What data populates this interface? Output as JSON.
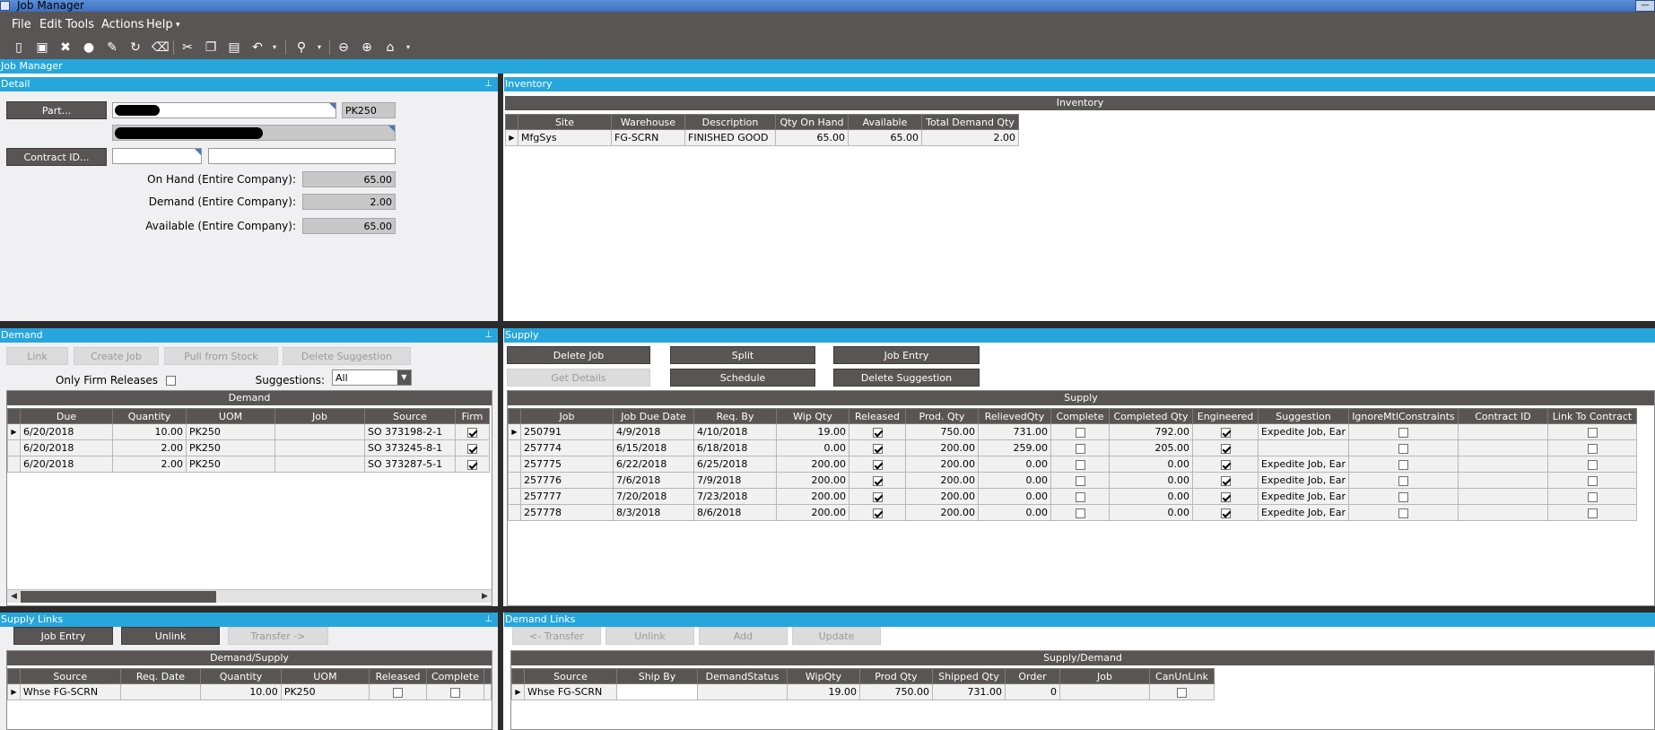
{
  "window": {
    "title": "Job Manager"
  },
  "menu": {
    "file": "File",
    "edit": "Edit",
    "tools": "Tools",
    "actions": "Actions",
    "help": "Help"
  },
  "app_strip": "Job Manager",
  "detail": {
    "title": "Detail",
    "part_button": "Part...",
    "part_value": "",
    "uom_value": "PK250",
    "description_value": "",
    "contract_button": "Contract ID...",
    "contract_value": "",
    "contract_desc": "",
    "on_hand_label": "On Hand (Entire Company):",
    "on_hand_value": "65.00",
    "demand_label": "Demand (Entire Company):",
    "demand_value": "2.00",
    "available_label": "Available (Entire Company):",
    "available_value": "65.00"
  },
  "inventory": {
    "title": "Inventory",
    "caption": "Inventory",
    "columns": [
      "Site",
      "Warehouse",
      "Description",
      "Qty On Hand",
      "Available",
      "Total Demand Qty"
    ],
    "rows": [
      [
        "MfgSys",
        "FG-SCRN",
        "FINISHED GOOD",
        "65.00",
        "65.00",
        "2.00"
      ]
    ]
  },
  "demand": {
    "title": "Demand",
    "buttons": {
      "link": "Link",
      "create_job": "Create Job",
      "pull_from_stock": "Pull from Stock",
      "delete_suggestion": "Delete Suggestion"
    },
    "only_firm_label": "Only Firm Releases",
    "suggestions_label": "Suggestions:",
    "suggestions_value": "All",
    "caption": "Demand",
    "columns": [
      "Due",
      "Quantity",
      "UOM",
      "Job",
      "Source",
      "Firm"
    ],
    "rows": [
      [
        "6/20/2018",
        "10.00",
        "PK250",
        "",
        "SO 373198-2-1"
      ],
      [
        "6/20/2018",
        "2.00",
        "PK250",
        "",
        "SO 373245-8-1"
      ],
      [
        "6/20/2018",
        "2.00",
        "PK250",
        "",
        "SO 373287-5-1"
      ]
    ]
  },
  "supply": {
    "title": "Supply",
    "buttons": {
      "delete_job": "Delete Job",
      "split": "Split",
      "job_entry": "Job Entry",
      "get_details": "Get Details",
      "schedule": "Schedule",
      "delete_suggestion": "Delete Suggestion"
    },
    "caption": "Supply",
    "columns": [
      "Job",
      "Job Due Date",
      "Req. By",
      "Wip Qty",
      "Released",
      "Prod. Qty",
      "RelievedQty",
      "Complete",
      "Completed Qty",
      "Engineered",
      "Suggestion",
      "IgnoreMtlConstraints",
      "Contract ID",
      "Link To Contract"
    ],
    "rows": [
      [
        "250791",
        "4/9/2018",
        "4/10/2018",
        "19.00",
        "750.00",
        "731.00",
        "792.00",
        "Expedite Job, Ear"
      ],
      [
        "257774",
        "6/15/2018",
        "6/18/2018",
        "0.00",
        "200.00",
        "259.00",
        "205.00",
        ""
      ],
      [
        "257775",
        "6/22/2018",
        "6/25/2018",
        "200.00",
        "200.00",
        "0.00",
        "0.00",
        "Expedite Job, Ear"
      ],
      [
        "257776",
        "7/6/2018",
        "7/9/2018",
        "200.00",
        "200.00",
        "0.00",
        "0.00",
        "Expedite Job, Ear"
      ],
      [
        "257777",
        "7/20/2018",
        "7/23/2018",
        "200.00",
        "200.00",
        "0.00",
        "0.00",
        "Expedite Job, Ear"
      ],
      [
        "257778",
        "8/3/2018",
        "8/6/2018",
        "200.00",
        "200.00",
        "0.00",
        "0.00",
        "Expedite Job, Ear"
      ]
    ]
  },
  "supply_links": {
    "title": "Supply Links",
    "buttons": {
      "job_entry": "Job Entry",
      "unlink": "Unlink",
      "transfer": "Transfer ->"
    },
    "caption": "Demand/Supply",
    "columns": [
      "Source",
      "Req. Date",
      "Quantity",
      "UOM",
      "Released",
      "Complete"
    ],
    "rows": [
      [
        "Whse FG-SCRN",
        "",
        "10.00",
        "PK250"
      ]
    ]
  },
  "demand_links": {
    "title": "Demand Links",
    "buttons": {
      "transfer": "<- Transfer",
      "unlink": "Unlink",
      "add": "Add",
      "update": "Update"
    },
    "caption": "Supply/Demand",
    "columns": [
      "Source",
      "Ship By",
      "DemandStatus",
      "WipQty",
      "Prod Qty",
      "Shipped Qty",
      "Order",
      "Job",
      "CanUnLink"
    ],
    "rows": [
      [
        "Whse FG-SCRN",
        "",
        "",
        "19.00",
        "750.00",
        "731.00",
        "0",
        ""
      ]
    ]
  }
}
